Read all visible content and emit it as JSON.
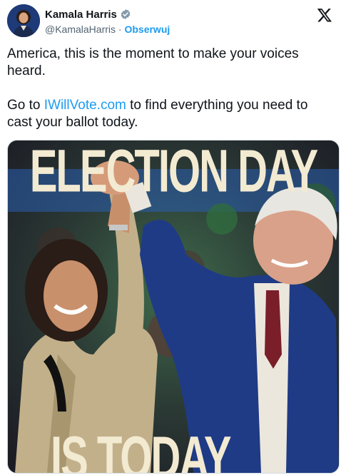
{
  "author": {
    "display_name": "Kamala Harris",
    "handle": "@KamalaHarris",
    "separator": "·",
    "follow_label": "Obserwuj",
    "avatar_icon": "avatar-photo",
    "verified_icon": "verified-badge-icon"
  },
  "platform": {
    "logo_icon": "x-logo-icon"
  },
  "tweet": {
    "line1": "America, this is the moment to make your voices heard.",
    "line2_before": "Go to ",
    "link_text": "IWillVote.com",
    "line2_after": " to find everything you need to cast your ballot today."
  },
  "media": {
    "headline_top": "ELECTION DAY",
    "headline_bottom": "IS TODAY"
  },
  "colors": {
    "link": "#1d9bf0",
    "text": "#0f1419",
    "muted": "#536471",
    "headline": "#f3ead2"
  }
}
